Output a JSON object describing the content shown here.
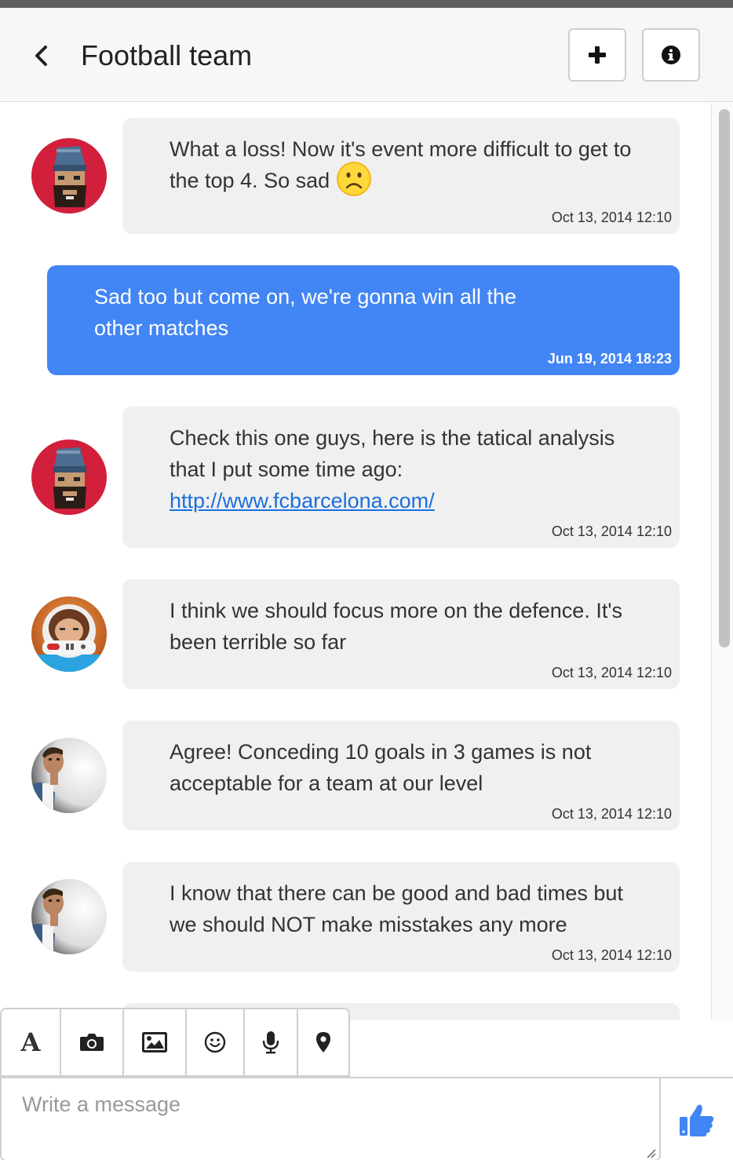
{
  "header": {
    "title": "Football team"
  },
  "messages": [
    {
      "text_before_link": "What a loss! Now it's event more difficult to get to the top 4. So sad",
      "time": "Oct 13, 2014 12:10",
      "own": false,
      "avatar": "beanie-man-avatar",
      "emoji": "sad-face"
    },
    {
      "text_before_link": "Sad too but come on, we're gonna win all the other matches",
      "time": "Jun 19, 2014 18:23",
      "own": true
    },
    {
      "text_before_link": "Check this one guys, here is the tatical analysis that I put some time ago:",
      "link": "http://www.fcbarcelona.com/",
      "time": "Oct 13, 2014 12:10",
      "own": false,
      "avatar": "beanie-man-avatar"
    },
    {
      "text_before_link": "I think we should focus more on the defence. It's been terrible so far",
      "time": "Oct 13, 2014 12:10",
      "own": false,
      "avatar": "astronaut-avatar"
    },
    {
      "text_before_link": "Agree! Conceding 10 goals in 3 games is not acceptable for a team at our level",
      "time": "Oct 13, 2014 12:10",
      "own": false,
      "avatar": "young-man-avatar"
    },
    {
      "text_before_link": "I know that there can be good and bad times but we should NOT make misstakes any more",
      "time": "Oct 13, 2014 12:10",
      "own": false,
      "avatar": "young-man-avatar"
    }
  ],
  "toolbar": {
    "font_label": "A",
    "icons": [
      "font-icon",
      "camera-icon",
      "image-icon",
      "emoji-icon",
      "microphone-icon",
      "location-pin-icon"
    ]
  },
  "composer": {
    "placeholder": "Write a message",
    "send_icon": "thumbs-up-icon"
  },
  "colors": {
    "own_bubble": "#4285f4",
    "other_bubble": "#f0f0f0",
    "link": "#1a6fe0",
    "like": "#4285f4"
  }
}
